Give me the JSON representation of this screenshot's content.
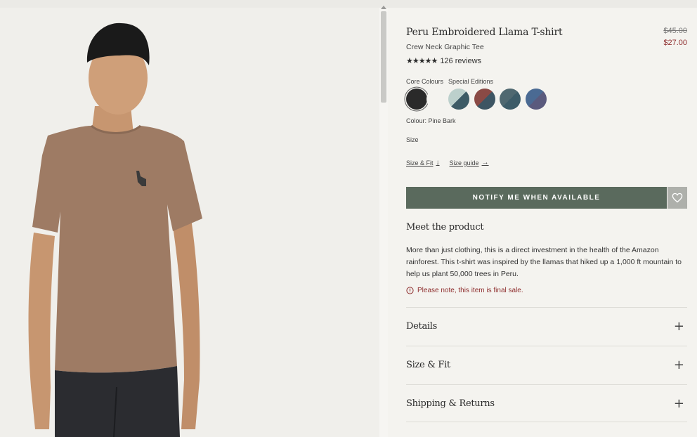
{
  "product": {
    "title": "Peru Embroidered Llama T-shirt",
    "subtitle": "Crew Neck Graphic Tee",
    "price_original": "$45.00",
    "price_sale": "$27.00",
    "rating_stars": "★★★★★",
    "reviews": "126 reviews",
    "image_icon": "model-in-brown-llama-tshirt"
  },
  "colours": {
    "core_label": "Core Colours",
    "special_label": "Special Editions",
    "selected_text": "Colour: Pine Bark",
    "core": [
      {
        "name": "black",
        "color": "#2a2a2a"
      },
      {
        "name": "white",
        "color": "#f4f3ef"
      }
    ],
    "special": [
      {
        "name": "sage-teal",
        "colors": [
          "#bcd0cc",
          "#3d5b66"
        ]
      },
      {
        "name": "teal-rust",
        "colors": [
          "#3d5563",
          "#8a4a45"
        ]
      },
      {
        "name": "teal-slate",
        "colors": [
          "#3d5c68",
          "#4f6870"
        ]
      },
      {
        "name": "blue-rust",
        "colors": [
          "#4a6a93",
          "#5a5a7d"
        ]
      }
    ]
  },
  "size": {
    "label": "Size",
    "size_fit_link": "Size & Fit",
    "size_guide_link": "Size guide"
  },
  "actions": {
    "notify_label": "NOTIFY ME WHEN AVAILABLE",
    "wishlist_icon": "heart-icon"
  },
  "meet": {
    "heading": "Meet the product",
    "description": "More than just clothing, this is a direct investment in the health of the Amazon rainforest. This t-shirt was inspired by the llamas that hiked up a 1,000 ft mountain to help us plant 50,000 trees in Peru.",
    "final_sale": "Please note, this item is final sale."
  },
  "accordions": [
    {
      "label": "Details"
    },
    {
      "label": "Size & Fit"
    },
    {
      "label": "Shipping & Returns"
    }
  ],
  "theme": {
    "accent_green": "#5a6a5d",
    "sale_red": "#8f2f2f",
    "background": "#f4f3ef"
  }
}
